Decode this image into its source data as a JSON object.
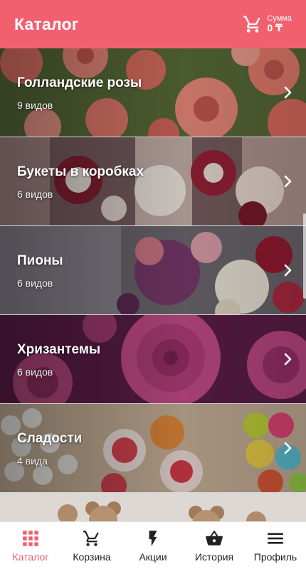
{
  "header": {
    "title": "Каталог",
    "sum_label": "Сумма",
    "sum_value": "0 ₸",
    "icon": "cart-icon"
  },
  "categories": [
    {
      "title": "Голландские розы",
      "count": "9 видов",
      "icon": "chevron-right-icon"
    },
    {
      "title": "Букеты в коробках",
      "count": "6 видов",
      "icon": "chevron-right-icon"
    },
    {
      "title": "Пионы",
      "count": "6 видов",
      "icon": "chevron-right-icon"
    },
    {
      "title": "Хризантемы",
      "count": "6 видов",
      "icon": "chevron-right-icon"
    },
    {
      "title": "Сладости",
      "count": "4 вида",
      "icon": "chevron-right-icon"
    }
  ],
  "nav": [
    {
      "label": "Каталог",
      "icon": "grid-icon",
      "active": true
    },
    {
      "label": "Корзина",
      "icon": "cart-icon",
      "active": false
    },
    {
      "label": "Акции",
      "icon": "lightning-icon",
      "active": false
    },
    {
      "label": "История",
      "icon": "basket-icon",
      "active": false
    },
    {
      "label": "Профиль",
      "icon": "menu-icon",
      "active": false
    }
  ],
  "colors": {
    "accent": "#f2606f",
    "nav_text": "#222222"
  }
}
